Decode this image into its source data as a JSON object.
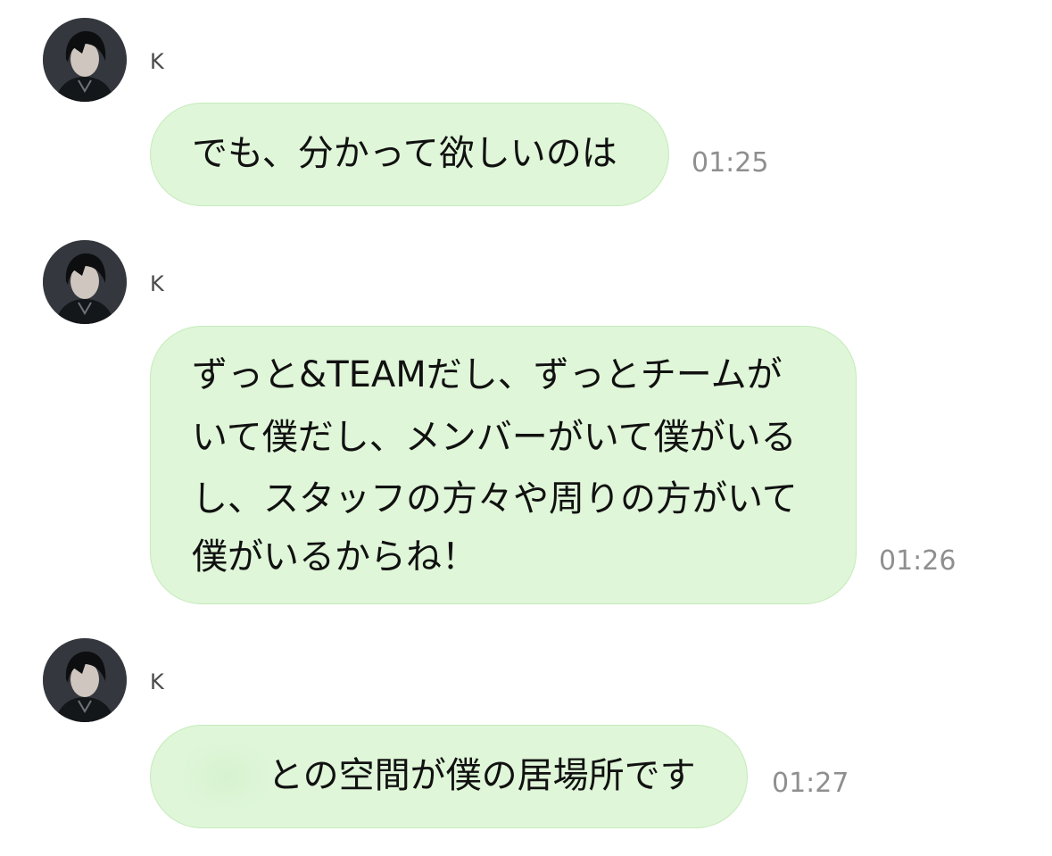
{
  "messages": [
    {
      "sender": "K",
      "text": "でも、分かって欲しいのは",
      "time": "01:25",
      "avatar_icon": "profile-photo-avatar"
    },
    {
      "sender": "K",
      "lines": [
        "ずっと&TEAMだし、ずっとチームが",
        "いて僕だし、メンバーがいて僕がいる",
        "し、スタッフの方々や周りの方がいて",
        "僕がいるからね！"
      ],
      "time": "01:26",
      "avatar_icon": "profile-photo-avatar"
    },
    {
      "sender": "K",
      "text": "との空間が僕の居場所です",
      "time": "01:27",
      "avatar_icon": "profile-photo-avatar"
    }
  ],
  "colors": {
    "bubble_bg": "#dff6d8",
    "bubble_border": "#c5ebbb",
    "time_text": "#8f8f8f",
    "sender_text": "#4a4a4a"
  }
}
